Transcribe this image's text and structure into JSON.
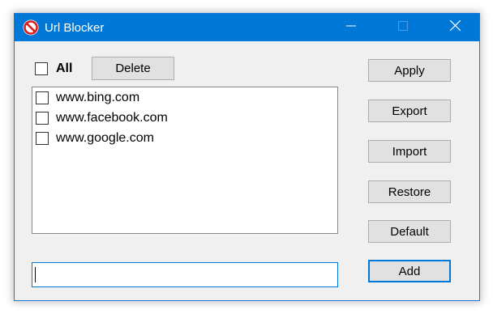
{
  "window": {
    "title": "Url Blocker",
    "accent_color": "#0078d7",
    "icon": "no-entry-icon",
    "controls": [
      "minimize-icon",
      "maximize-icon",
      "close-icon"
    ]
  },
  "toolbar": {
    "all_label": "All",
    "all_checked": false,
    "delete_label": "Delete"
  },
  "url_list": [
    {
      "url": "www.bing.com",
      "checked": false
    },
    {
      "url": "www.facebook.com",
      "checked": false
    },
    {
      "url": "www.google.com",
      "checked": false
    }
  ],
  "side_buttons": {
    "apply": "Apply",
    "export": "Export",
    "import": "Import",
    "restore": "Restore",
    "default": "Default",
    "add": "Add"
  },
  "url_input": {
    "value": "",
    "placeholder": ""
  }
}
